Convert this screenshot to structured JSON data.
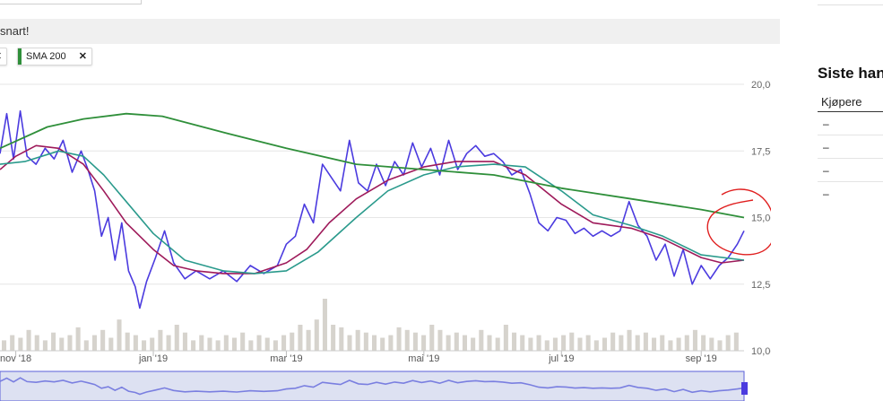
{
  "notice": {
    "text": "snart!"
  },
  "indicator_chips": [
    {
      "label": "",
      "color": "#c02020"
    },
    {
      "label": "SMA 200",
      "color": "#2f8f3a"
    }
  ],
  "side_panel": {
    "title": "Siste han",
    "column_header": "Kjøpere",
    "rows": [
      "–",
      "–",
      "–",
      "–"
    ]
  },
  "colors": {
    "price": "#4b3bdf",
    "sma_fast": "#9e1a5a",
    "sma_mid": "#2a9a8c",
    "sma_200": "#2f8f3a",
    "volume": "#d6d3cd",
    "navigator_fill": "#dde1f2",
    "navigator_line": "#7a7fe0",
    "annotation": "#e02020"
  },
  "chart_data": {
    "type": "line",
    "x_start": "2018-10-25",
    "x_end": "2019-09-20",
    "y_ticks": [
      "20,00",
      "17,50",
      "15,00",
      "12,50",
      "10,00"
    ],
    "y_tick_values": [
      20,
      17.5,
      15,
      12.5,
      10
    ],
    "x_ticks": [
      {
        "date": "2018-11-01",
        "label": "nov '18"
      },
      {
        "date": "2019-01-01",
        "label": "jan '19"
      },
      {
        "date": "2019-03-01",
        "label": "mar '19"
      },
      {
        "date": "2019-05-01",
        "label": "mai '19"
      },
      {
        "date": "2019-07-01",
        "label": "jul '19"
      },
      {
        "date": "2019-09-01",
        "label": "sep '19"
      }
    ],
    "series": [
      {
        "key": "price",
        "points": [
          [
            "2018-10-25",
            17.4
          ],
          [
            "2018-10-28",
            18.9
          ],
          [
            "2018-10-31",
            17.2
          ],
          [
            "2018-11-03",
            19.0
          ],
          [
            "2018-11-06",
            17.3
          ],
          [
            "2018-11-10",
            17.0
          ],
          [
            "2018-11-14",
            17.6
          ],
          [
            "2018-11-18",
            17.2
          ],
          [
            "2018-11-22",
            17.9
          ],
          [
            "2018-11-26",
            16.7
          ],
          [
            "2018-11-30",
            17.5
          ],
          [
            "2018-12-03",
            16.8
          ],
          [
            "2018-12-06",
            16.0
          ],
          [
            "2018-12-09",
            14.3
          ],
          [
            "2018-12-12",
            15.0
          ],
          [
            "2018-12-15",
            13.4
          ],
          [
            "2018-12-18",
            14.8
          ],
          [
            "2018-12-21",
            13.0
          ],
          [
            "2018-12-24",
            12.4
          ],
          [
            "2018-12-26",
            11.6
          ],
          [
            "2018-12-29",
            12.6
          ],
          [
            "2019-01-02",
            13.5
          ],
          [
            "2019-01-06",
            14.5
          ],
          [
            "2019-01-10",
            13.3
          ],
          [
            "2019-01-15",
            12.7
          ],
          [
            "2019-01-20",
            13.0
          ],
          [
            "2019-01-26",
            12.7
          ],
          [
            "2019-02-01",
            13.0
          ],
          [
            "2019-02-07",
            12.6
          ],
          [
            "2019-02-13",
            13.2
          ],
          [
            "2019-02-19",
            12.9
          ],
          [
            "2019-02-25",
            13.2
          ],
          [
            "2019-03-01",
            14.0
          ],
          [
            "2019-03-05",
            14.3
          ],
          [
            "2019-03-09",
            15.5
          ],
          [
            "2019-03-13",
            14.8
          ],
          [
            "2019-03-17",
            17.0
          ],
          [
            "2019-03-21",
            16.5
          ],
          [
            "2019-03-25",
            16.0
          ],
          [
            "2019-03-29",
            17.9
          ],
          [
            "2019-04-02",
            16.3
          ],
          [
            "2019-04-06",
            16.0
          ],
          [
            "2019-04-10",
            17.0
          ],
          [
            "2019-04-14",
            16.2
          ],
          [
            "2019-04-18",
            17.1
          ],
          [
            "2019-04-22",
            16.6
          ],
          [
            "2019-04-26",
            17.8
          ],
          [
            "2019-04-30",
            16.9
          ],
          [
            "2019-05-04",
            17.6
          ],
          [
            "2019-05-08",
            16.6
          ],
          [
            "2019-05-12",
            17.9
          ],
          [
            "2019-05-16",
            16.8
          ],
          [
            "2019-05-20",
            17.4
          ],
          [
            "2019-05-24",
            17.7
          ],
          [
            "2019-05-28",
            17.3
          ],
          [
            "2019-06-01",
            17.4
          ],
          [
            "2019-06-05",
            17.1
          ],
          [
            "2019-06-09",
            16.6
          ],
          [
            "2019-06-13",
            16.8
          ],
          [
            "2019-06-17",
            15.9
          ],
          [
            "2019-06-21",
            14.8
          ],
          [
            "2019-06-25",
            14.5
          ],
          [
            "2019-06-29",
            15.0
          ],
          [
            "2019-07-03",
            14.9
          ],
          [
            "2019-07-07",
            14.4
          ],
          [
            "2019-07-11",
            14.6
          ],
          [
            "2019-07-15",
            14.3
          ],
          [
            "2019-07-19",
            14.5
          ],
          [
            "2019-07-23",
            14.3
          ],
          [
            "2019-07-27",
            14.5
          ],
          [
            "2019-07-31",
            15.6
          ],
          [
            "2019-08-04",
            14.7
          ],
          [
            "2019-08-08",
            14.3
          ],
          [
            "2019-08-12",
            13.4
          ],
          [
            "2019-08-16",
            14.0
          ],
          [
            "2019-08-20",
            12.8
          ],
          [
            "2019-08-24",
            13.8
          ],
          [
            "2019-08-28",
            12.5
          ],
          [
            "2019-09-01",
            13.2
          ],
          [
            "2019-09-05",
            12.7
          ],
          [
            "2019-09-09",
            13.2
          ],
          [
            "2019-09-13",
            13.5
          ],
          [
            "2019-09-17",
            14.0
          ],
          [
            "2019-09-20",
            14.5
          ]
        ]
      },
      {
        "key": "sma_fast",
        "points": [
          [
            "2018-10-25",
            16.8
          ],
          [
            "2018-11-01",
            17.3
          ],
          [
            "2018-11-10",
            17.7
          ],
          [
            "2018-11-20",
            17.6
          ],
          [
            "2018-12-01",
            17.0
          ],
          [
            "2018-12-10",
            16.0
          ],
          [
            "2018-12-20",
            14.8
          ],
          [
            "2019-01-01",
            13.8
          ],
          [
            "2019-01-10",
            13.2
          ],
          [
            "2019-01-20",
            13.0
          ],
          [
            "2019-02-01",
            12.9
          ],
          [
            "2019-02-15",
            12.9
          ],
          [
            "2019-03-01",
            13.3
          ],
          [
            "2019-03-10",
            13.8
          ],
          [
            "2019-03-20",
            14.8
          ],
          [
            "2019-04-01",
            15.7
          ],
          [
            "2019-04-15",
            16.4
          ],
          [
            "2019-05-01",
            16.9
          ],
          [
            "2019-05-15",
            17.1
          ],
          [
            "2019-06-01",
            17.1
          ],
          [
            "2019-06-15",
            16.6
          ],
          [
            "2019-07-01",
            15.5
          ],
          [
            "2019-07-15",
            14.8
          ],
          [
            "2019-08-01",
            14.6
          ],
          [
            "2019-08-15",
            14.2
          ],
          [
            "2019-09-01",
            13.5
          ],
          [
            "2019-09-10",
            13.3
          ],
          [
            "2019-09-20",
            13.4
          ]
        ]
      },
      {
        "key": "sma_mid",
        "points": [
          [
            "2018-10-25",
            17.0
          ],
          [
            "2018-11-05",
            17.1
          ],
          [
            "2018-11-20",
            17.5
          ],
          [
            "2018-12-01",
            17.3
          ],
          [
            "2018-12-10",
            16.6
          ],
          [
            "2018-12-20",
            15.6
          ],
          [
            "2019-01-01",
            14.4
          ],
          [
            "2019-01-15",
            13.4
          ],
          [
            "2019-02-01",
            13.0
          ],
          [
            "2019-02-15",
            12.9
          ],
          [
            "2019-03-01",
            13.0
          ],
          [
            "2019-03-15",
            13.7
          ],
          [
            "2019-04-01",
            15.0
          ],
          [
            "2019-04-15",
            16.0
          ],
          [
            "2019-05-01",
            16.6
          ],
          [
            "2019-05-15",
            16.9
          ],
          [
            "2019-06-01",
            17.0
          ],
          [
            "2019-06-15",
            16.9
          ],
          [
            "2019-07-01",
            16.0
          ],
          [
            "2019-07-15",
            15.1
          ],
          [
            "2019-08-01",
            14.7
          ],
          [
            "2019-08-15",
            14.3
          ],
          [
            "2019-09-01",
            13.6
          ],
          [
            "2019-09-20",
            13.4
          ]
        ]
      },
      {
        "key": "sma_200",
        "points": [
          [
            "2018-10-25",
            17.6
          ],
          [
            "2018-11-15",
            18.4
          ],
          [
            "2018-12-01",
            18.7
          ],
          [
            "2018-12-20",
            18.9
          ],
          [
            "2019-01-05",
            18.8
          ],
          [
            "2019-02-01",
            18.2
          ],
          [
            "2019-03-01",
            17.6
          ],
          [
            "2019-04-01",
            17.0
          ],
          [
            "2019-05-01",
            16.8
          ],
          [
            "2019-06-01",
            16.6
          ],
          [
            "2019-07-01",
            16.1
          ],
          [
            "2019-08-01",
            15.7
          ],
          [
            "2019-09-01",
            15.3
          ],
          [
            "2019-09-20",
            15.0
          ]
        ]
      }
    ],
    "volume": [
      0.2,
      0.3,
      0.25,
      0.4,
      0.3,
      0.2,
      0.35,
      0.25,
      0.3,
      0.45,
      0.2,
      0.3,
      0.4,
      0.25,
      0.6,
      0.35,
      0.3,
      0.2,
      0.25,
      0.4,
      0.3,
      0.5,
      0.35,
      0.2,
      0.3,
      0.25,
      0.2,
      0.3,
      0.25,
      0.35,
      0.2,
      0.3,
      0.25,
      0.2,
      0.3,
      0.35,
      0.5,
      0.4,
      0.6,
      1.0,
      0.5,
      0.45,
      0.3,
      0.4,
      0.35,
      0.3,
      0.25,
      0.3,
      0.45,
      0.4,
      0.35,
      0.3,
      0.5,
      0.4,
      0.3,
      0.35,
      0.3,
      0.25,
      0.4,
      0.3,
      0.25,
      0.5,
      0.35,
      0.3,
      0.25,
      0.3,
      0.2,
      0.25,
      0.3,
      0.35,
      0.25,
      0.3,
      0.2,
      0.25,
      0.35,
      0.3,
      0.4,
      0.3,
      0.35,
      0.25,
      0.3,
      0.2,
      0.25,
      0.3,
      0.4,
      0.3,
      0.25,
      0.2,
      0.3,
      0.35
    ]
  }
}
